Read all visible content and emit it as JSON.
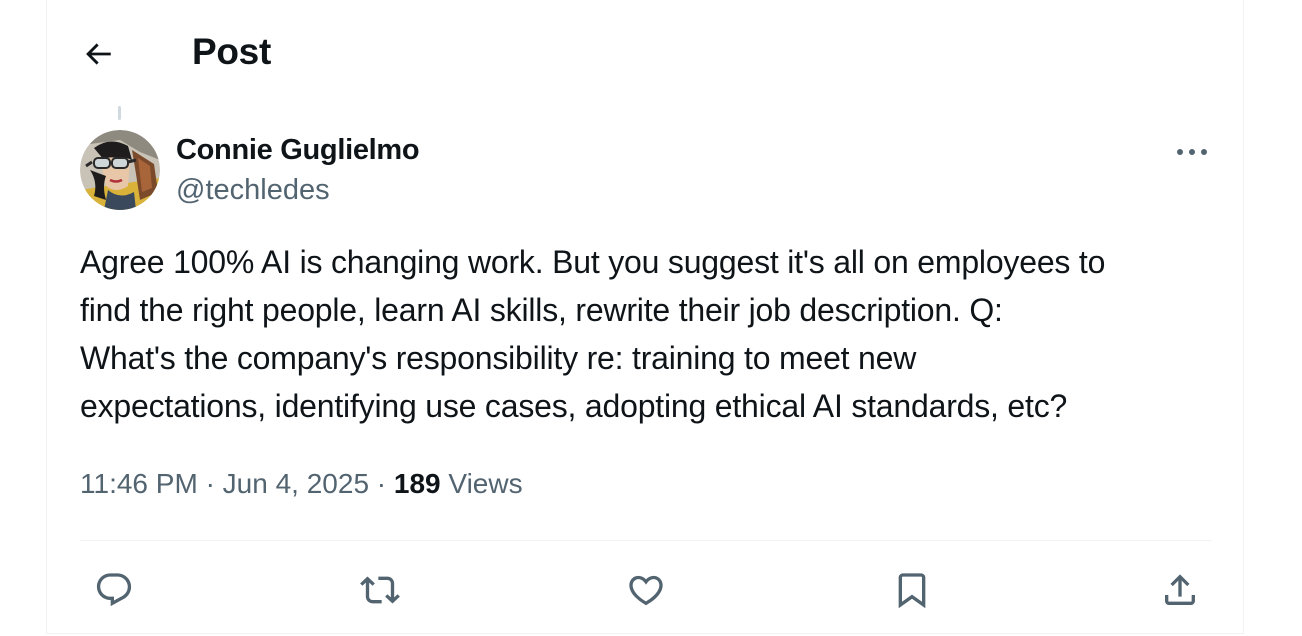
{
  "header": {
    "title": "Post",
    "back_icon": "arrow-left-icon"
  },
  "post": {
    "author": {
      "name": "Connie Guglielmo",
      "handle": "@techledes",
      "avatar": "illustrated-aviator-avatar"
    },
    "text": "Agree 100% AI is changing work. But you suggest it's all on employees to\nfind the right people, learn AI skills, rewrite their job description. Q:\nWhat's the company's responsibility re: training to meet new\nexpectations, identifying use cases, adopting ethical AI standards, etc?",
    "time": "11:46 PM",
    "separator": "·",
    "date": "Jun 4, 2025",
    "views_count": "189",
    "views_label": "Views"
  },
  "actions": {
    "reply_icon": "reply-icon",
    "repost_icon": "repost-icon",
    "like_icon": "heart-icon",
    "bookmark_icon": "bookmark-icon",
    "share_icon": "share-icon"
  },
  "colors": {
    "text_primary": "#0f1419",
    "text_secondary": "#536471",
    "divider": "#eff3f4",
    "icon": "#536471"
  }
}
